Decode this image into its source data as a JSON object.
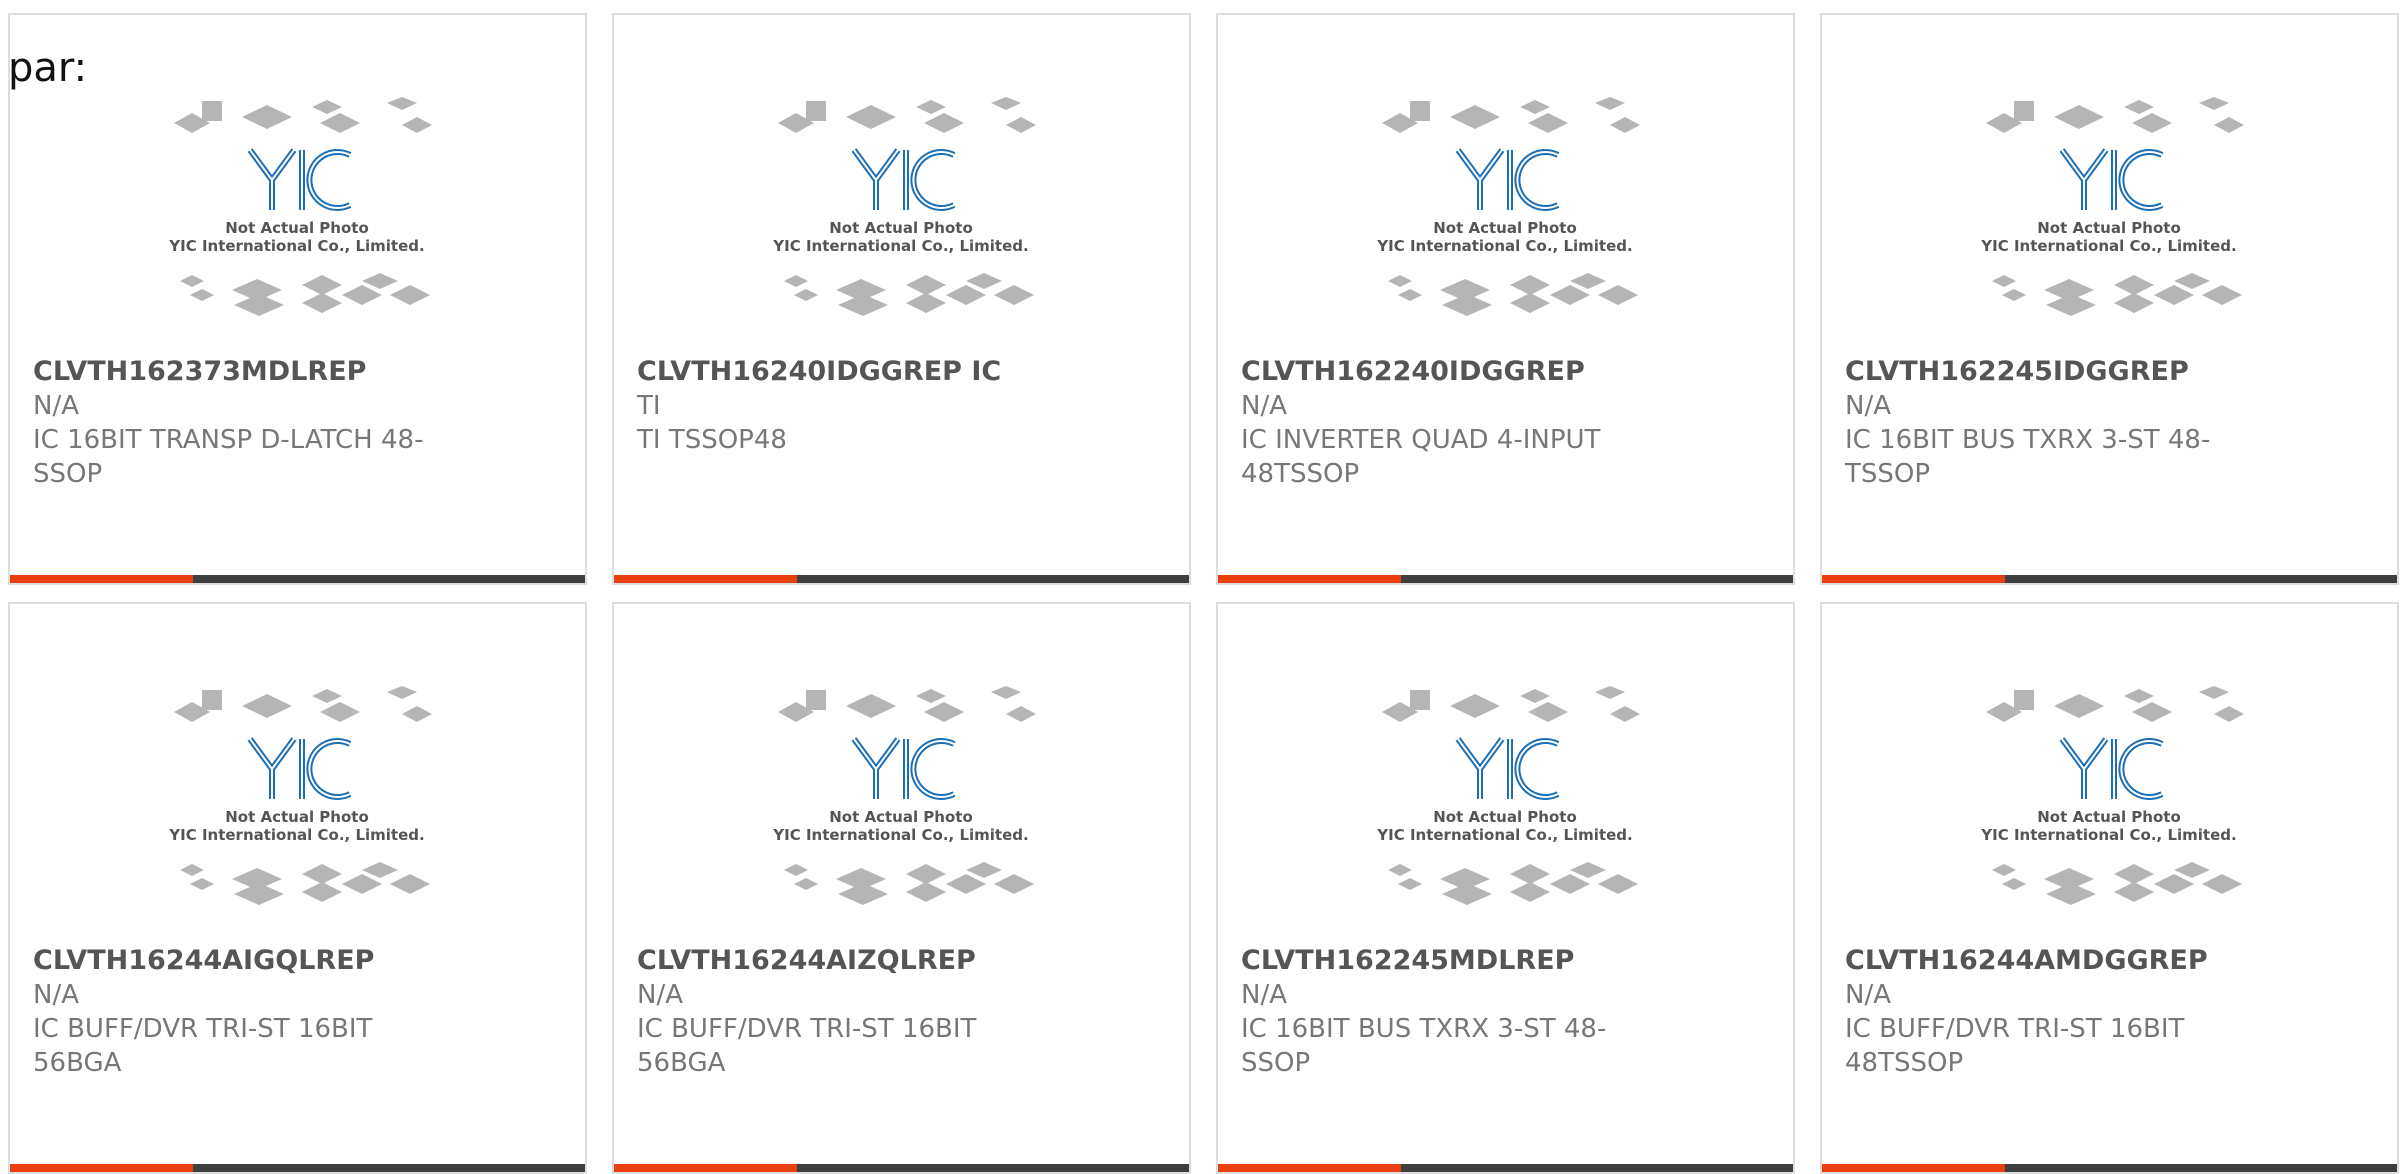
{
  "prefix_text": "par:",
  "thumbnail": {
    "caption_line1": "Not Actual Photo",
    "caption_line2": "YIC International Co., Limited.",
    "logo_text": "YIC"
  },
  "colors": {
    "accent": "#e8400e",
    "bar": "#3f3f3f",
    "logo_blue": "#1b6fb6",
    "chip_gray": "#b5b5b5"
  },
  "products": [
    {
      "name": "CLVTH162373MDLREP",
      "manufacturer": "N/A",
      "description": "IC 16BIT TRANSP D-LATCH 48-\nSSOP"
    },
    {
      "name": "CLVTH16240IDGGREP IC",
      "manufacturer": "TI",
      "description": "TI TSSOP48"
    },
    {
      "name": "CLVTH162240IDGGREP",
      "manufacturer": "N/A",
      "description": "IC INVERTER QUAD 4-INPUT\n48TSSOP"
    },
    {
      "name": "CLVTH162245IDGGREP",
      "manufacturer": "N/A",
      "description": "IC 16BIT BUS TXRX 3-ST 48-\nTSSOP"
    },
    {
      "name": "CLVTH16244AIGQLREP",
      "manufacturer": "N/A",
      "description": "IC BUFF/DVR TRI-ST 16BIT\n56BGA"
    },
    {
      "name": "CLVTH16244AIZQLREP",
      "manufacturer": "N/A",
      "description": "IC BUFF/DVR TRI-ST 16BIT\n56BGA"
    },
    {
      "name": "CLVTH162245MDLREP",
      "manufacturer": "N/A",
      "description": "IC 16BIT BUS TXRX 3-ST 48-\nSSOP"
    },
    {
      "name": "CLVTH16244AMDGGREP",
      "manufacturer": "N/A",
      "description": "IC BUFF/DVR TRI-ST 16BIT\n48TSSOP"
    }
  ]
}
